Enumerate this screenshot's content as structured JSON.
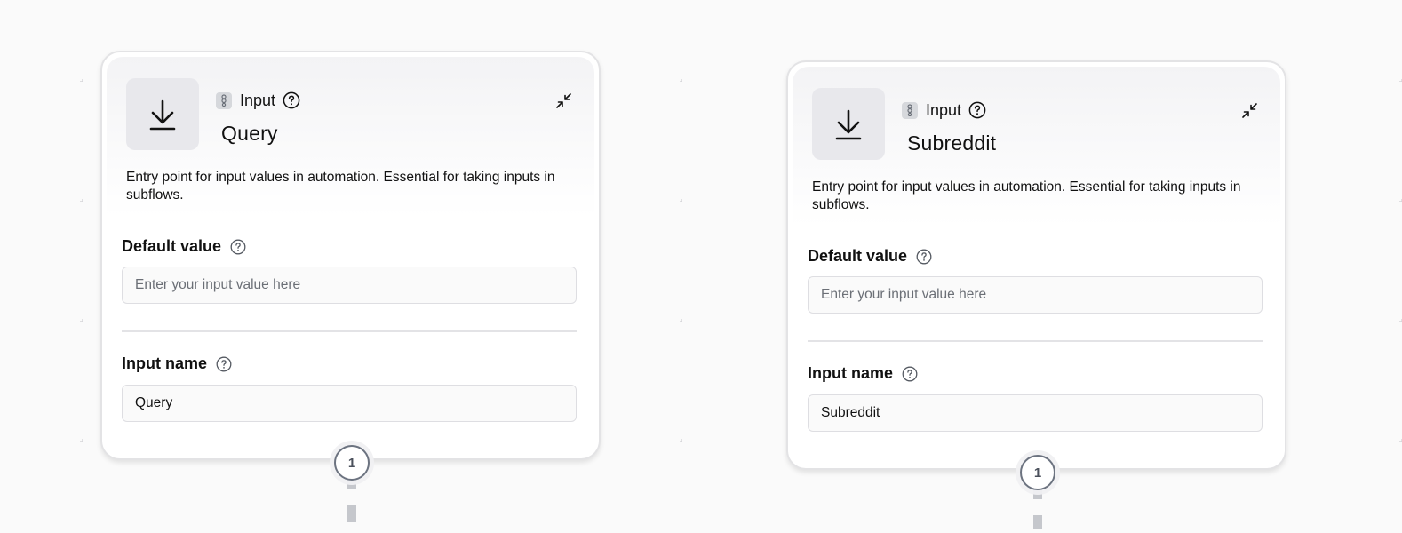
{
  "nodes": [
    {
      "type_label": "Input",
      "title": "Query",
      "description": "Entry point for input values in automation. Essential for taking inputs in subflows.",
      "default_value": {
        "label": "Default value",
        "value": "",
        "placeholder": "Enter your input value here"
      },
      "input_name": {
        "label": "Input name",
        "value": "Query"
      },
      "port_label": "1"
    },
    {
      "type_label": "Input",
      "title": "Subreddit",
      "description": "Entry point for input values in automation. Essential for taking inputs in subflows.",
      "default_value": {
        "label": "Default value",
        "value": "",
        "placeholder": "Enter your input value here"
      },
      "input_name": {
        "label": "Input name",
        "value": "Subreddit"
      },
      "port_label": "1"
    }
  ],
  "icons": {
    "node_icon": "download-arrow-icon",
    "type_chip": "variable-chip-icon",
    "help": "question-circle-icon",
    "collapse": "collapse-arrows-icon"
  },
  "colors": {
    "canvas_bg": "#fafafa",
    "grid_cross": "#d4d4d8",
    "node_border": "#e3e3e5",
    "port_border": "#6c7380",
    "edge": "#c5c7cc"
  }
}
